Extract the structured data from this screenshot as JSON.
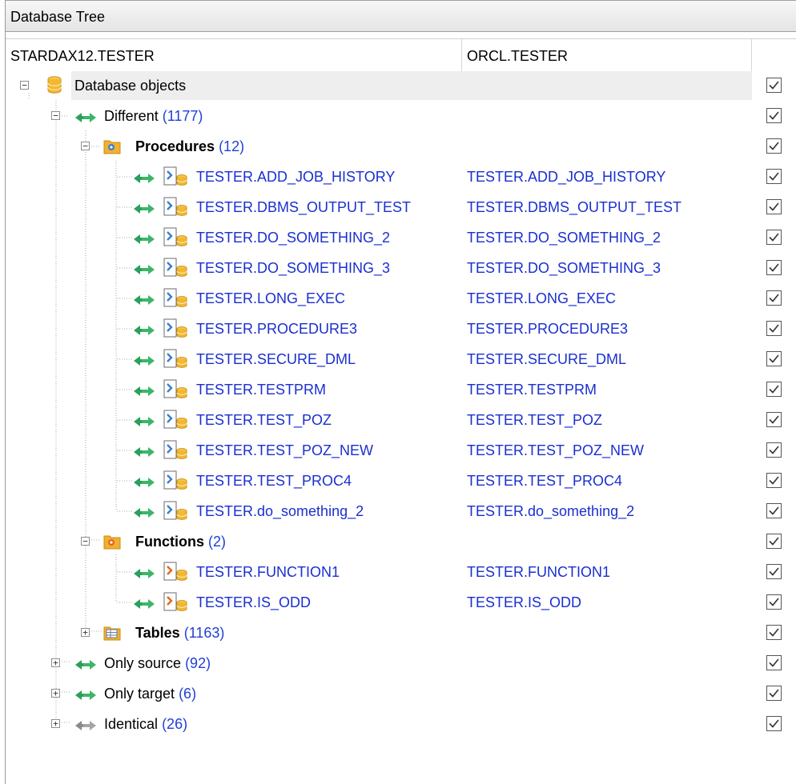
{
  "panel": {
    "title": "Database Tree"
  },
  "columns": {
    "source": "STARDAX12.TESTER",
    "target": "ORCL.TESTER"
  },
  "root": {
    "label": "Database objects",
    "checked": true
  },
  "different": {
    "label": "Different",
    "count": "(1177)",
    "checked": true
  },
  "procedures": {
    "label": "Procedures",
    "count": "(12)",
    "items": [
      {
        "source": "TESTER.ADD_JOB_HISTORY",
        "target": "TESTER.ADD_JOB_HISTORY"
      },
      {
        "source": "TESTER.DBMS_OUTPUT_TEST",
        "target": "TESTER.DBMS_OUTPUT_TEST"
      },
      {
        "source": "TESTER.DO_SOMETHING_2",
        "target": "TESTER.DO_SOMETHING_2"
      },
      {
        "source": "TESTER.DO_SOMETHING_3",
        "target": "TESTER.DO_SOMETHING_3"
      },
      {
        "source": "TESTER.LONG_EXEC",
        "target": "TESTER.LONG_EXEC"
      },
      {
        "source": "TESTER.PROCEDURE3",
        "target": "TESTER.PROCEDURE3"
      },
      {
        "source": "TESTER.SECURE_DML",
        "target": "TESTER.SECURE_DML"
      },
      {
        "source": "TESTER.TESTPRM",
        "target": "TESTER.TESTPRM"
      },
      {
        "source": "TESTER.TEST_POZ",
        "target": "TESTER.TEST_POZ"
      },
      {
        "source": "TESTER.TEST_POZ_NEW",
        "target": "TESTER.TEST_POZ_NEW"
      },
      {
        "source": "TESTER.TEST_PROC4",
        "target": "TESTER.TEST_PROC4"
      },
      {
        "source": "TESTER.do_something_2",
        "target": "TESTER.do_something_2"
      }
    ]
  },
  "functions": {
    "label": "Functions",
    "count": "(2)",
    "items": [
      {
        "source": "TESTER.FUNCTION1",
        "target": "TESTER.FUNCTION1"
      },
      {
        "source": "TESTER.IS_ODD",
        "target": "TESTER.IS_ODD"
      }
    ]
  },
  "tables": {
    "label": "Tables",
    "count": "(1163)"
  },
  "only_source": {
    "label": "Only source",
    "count": "(92)"
  },
  "only_target": {
    "label": "Only target",
    "count": "(6)"
  },
  "identical": {
    "label": "Identical",
    "count": "(26)"
  },
  "icons": {
    "database": "database-icon",
    "diff_arrows": "diff-arrows-icon",
    "procedure_folder": "procedure-folder-icon",
    "function_folder": "function-folder-icon",
    "table_folder": "table-folder-icon",
    "procedure": "procedure-icon",
    "function": "function-icon"
  },
  "colors": {
    "link": "#1a2fd0",
    "count": "#1f3fd6",
    "arrow_green": "#2aa05a",
    "folder": "#f0b030"
  }
}
